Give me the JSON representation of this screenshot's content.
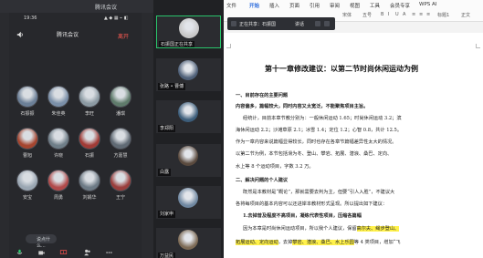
{
  "meeting": {
    "window_title": "腾讯会议",
    "status_time": "19:36",
    "status_icons": "▲ ◆ ▦ ⌁ ◧",
    "header": {
      "name": "腾讯会议",
      "elapsed": "",
      "leave_label": "离开"
    },
    "participants": [
      {
        "label": "石振振",
        "avatar_color": "#6b7f97"
      },
      {
        "label": "朱佳英",
        "avatar_color": "#7a8fa8"
      },
      {
        "label": "李旺",
        "avatar_color": "#8c9aa3"
      },
      {
        "label": "潘琪",
        "avatar_color": "#5f7b6b"
      },
      {
        "label": "曹旭",
        "avatar_color": "#a5452f"
      },
      {
        "label": "许晓",
        "avatar_color": "#6f7e88"
      },
      {
        "label": "石振",
        "avatar_color": "#a13b36"
      },
      {
        "label": "方嘉慧",
        "avatar_color": "#606a74"
      },
      {
        "label": "安宝",
        "avatar_color": "#9aa6b2"
      },
      {
        "label": "周勇",
        "avatar_color": "#b14a4a"
      },
      {
        "label": "刘娟华",
        "avatar_color": "#6d7a85"
      },
      {
        "label": "王宁",
        "avatar_color": "#9a3e3c"
      }
    ],
    "bubble_text": "说点什么...",
    "toolbar_icons": [
      "mic-icon",
      "camera-icon",
      "share-screen-icon",
      "members-icon",
      "more-icon"
    ]
  },
  "video_strip": [
    {
      "label": "石振国正在共享",
      "color": "#c8c8c8"
    },
    {
      "label": "张路 • 曹傅",
      "color": "#4f6078"
    },
    {
      "label": "李郑阳",
      "color": "#3c5d7a"
    },
    {
      "label": "白露",
      "color": "#5a4a3e"
    },
    {
      "label": "刘家申",
      "color": "#6f87a0"
    },
    {
      "label": "万益民",
      "color": "#7c6a55"
    }
  ],
  "wps": {
    "tabs": [
      "文件",
      "开始",
      "插入",
      "页面",
      "引用",
      "审阅",
      "视图",
      "工具",
      "会员专享",
      "WPS AI"
    ],
    "active_tab": "开始",
    "ribbon_row": [
      "宋体",
      "五号",
      "B",
      "I",
      "U",
      "A",
      "≡",
      "≡",
      "≡",
      "标题1",
      "正文"
    ],
    "share_bar": {
      "label": "正在共享：石振国",
      "extra": "讲话"
    }
  },
  "document": {
    "title": "第十一章修改建议：以第二节时尚休闲运动为例",
    "lines": [
      {
        "text": "一、目前存在的主要问题",
        "bold": true
      },
      {
        "text": "内容偏多，篇幅较大，同时内容又太宽泛，不能聚焦项目主旨。",
        "bold": true
      },
      {
        "text": "经统计，目前本章节教分别为：一般休闲运动 1.65；时尚休闲运动 3.2；滨",
        "bold": false
      },
      {
        "text": "海休闲运动 2.2；沙滩草原 2.1；冰雪 1.4；定位 1.2；心智 0.8，共计 12.5。",
        "bold": false
      },
      {
        "text": "作为一章内容来说篇幅显得较长，同时也存在各章节篇幅差异性太大的情况。",
        "bold": false
      },
      {
        "text": "以第二节为例，本节包括滑为冬、登山、攀岩、拓展、潜浪、桑巴、定向、",
        "bold": false
      },
      {
        "text": "水上等 8 个运动项目，字数 3.2 万。",
        "bold": false
      },
      {
        "text": "二、解决问题的个人建议",
        "bold": true
      },
      {
        "text": "既然是本教材是“概论”，那就需要去判为主，但要“引人入胜”，不建议大",
        "bold": false
      },
      {
        "text": "各将每项目的基本内容可以还进岸本教材形式呈现。所以提出如下建议：",
        "bold": false
      },
      {
        "text": "1.去掉普及程度不高项目，凝练代表性项目，压缩各篇幅",
        "bold": true
      },
      {
        "text": "因为本章是时尚休闲运动项目，所以我个人建议，保留",
        "bold": false,
        "hl": "高尔夫、绳步登山、"
      },
      {
        "text": "",
        "bold": false,
        "hl": "拓展运动、定向运动",
        "after": "，去掉",
        "hl2": "攀岩、潜浪、桑巴、水上乐园",
        "after2": "等 4 类项目，增加“飞"
      }
    ]
  }
}
